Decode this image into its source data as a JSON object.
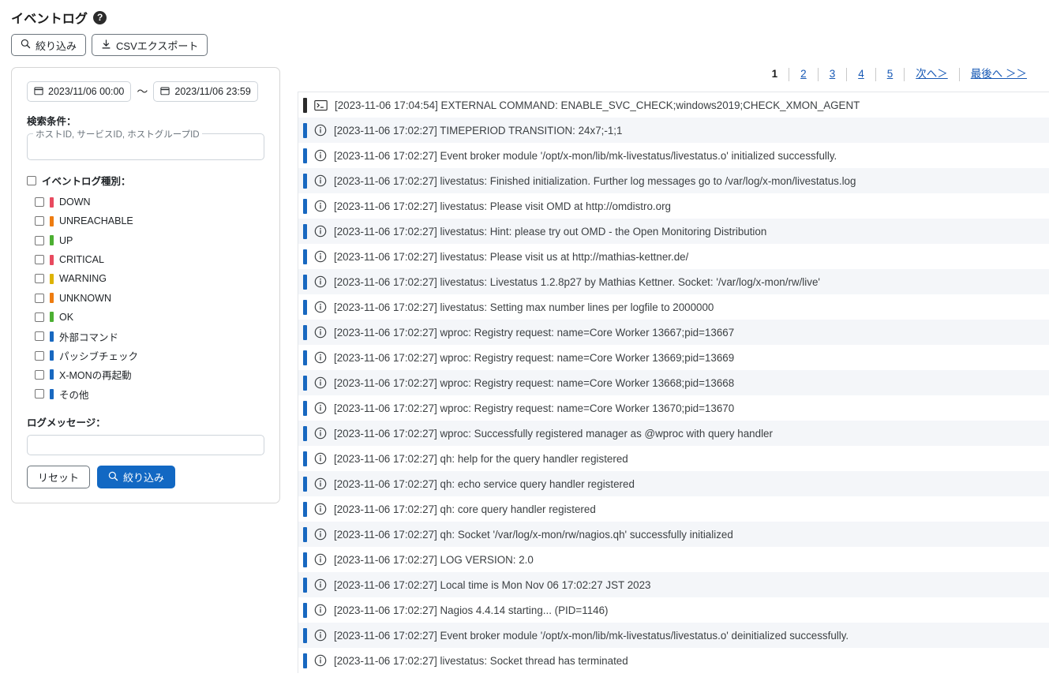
{
  "header": {
    "title": "イベントログ",
    "help_icon": "help-circle-icon",
    "help_label": "?",
    "toolbar": [
      {
        "label": "絞り込み",
        "icon": "search-icon"
      },
      {
        "label": "CSVエクスポート",
        "icon": "download-icon"
      }
    ]
  },
  "filter": {
    "date_from": "2023/11/06 00:00",
    "date_to": "2023/11/06 23:59",
    "date_separator": "～",
    "calendar_icon": "calendar-icon",
    "search_condition_label": "検索条件：",
    "id_field_legend": "ホストID, サービスID, ホストグループID",
    "id_field_value": "",
    "category_label": "イベントログ種別：",
    "categories": [
      {
        "label": "DOWN",
        "color": "#e84a5f",
        "checked": false
      },
      {
        "label": "UNREACHABLE",
        "color": "#ee7c10",
        "checked": false
      },
      {
        "label": "UP",
        "color": "#4caf32",
        "checked": false
      },
      {
        "label": "CRITICAL",
        "color": "#e84a5f",
        "checked": false
      },
      {
        "label": "WARNING",
        "color": "#ddb302",
        "checked": false
      },
      {
        "label": "UNKNOWN",
        "color": "#ee7c10",
        "checked": false
      },
      {
        "label": "OK",
        "color": "#4caf32",
        "checked": false
      },
      {
        "label": "外部コマンド",
        "color": "#1868c0",
        "checked": false
      },
      {
        "label": "パッシブチェック",
        "color": "#1868c0",
        "checked": false
      },
      {
        "label": "X-MONの再起動",
        "color": "#1868c0",
        "checked": false
      },
      {
        "label": "その他",
        "color": "#1868c0",
        "checked": false
      }
    ],
    "log_message_label": "ログメッセージ：",
    "log_message_value": "",
    "log_message_placeholder": "",
    "reset_label": "リセット",
    "apply_label": "絞り込み",
    "apply_icon": "search-icon"
  },
  "pagination": {
    "pages": [
      {
        "label": "1",
        "current": true
      },
      {
        "label": "2",
        "current": false
      },
      {
        "label": "3",
        "current": false
      },
      {
        "label": "4",
        "current": false
      },
      {
        "label": "5",
        "current": false
      },
      {
        "label": "次へ＞",
        "current": false
      },
      {
        "label": "最後へ ＞＞",
        "current": false
      }
    ]
  },
  "log_rows": [
    {
      "bar_color": "#2b2b2b",
      "icon": "terminal-icon",
      "text": "[2023-11-06 17:04:54] EXTERNAL COMMAND: ENABLE_SVC_CHECK;windows2019;CHECK_XMON_AGENT"
    },
    {
      "bar_color": "#1868c0",
      "icon": "info-circle-icon",
      "text": "[2023-11-06 17:02:27] TIMEPERIOD TRANSITION: 24x7;-1;1"
    },
    {
      "bar_color": "#1868c0",
      "icon": "info-circle-icon",
      "text": "[2023-11-06 17:02:27] Event broker module '/opt/x-mon/lib/mk-livestatus/livestatus.o' initialized successfully."
    },
    {
      "bar_color": "#1868c0",
      "icon": "info-circle-icon",
      "text": "[2023-11-06 17:02:27] livestatus: Finished initialization. Further log messages go to /var/log/x-mon/livestatus.log"
    },
    {
      "bar_color": "#1868c0",
      "icon": "info-circle-icon",
      "text": "[2023-11-06 17:02:27] livestatus: Please visit OMD at http://omdistro.org"
    },
    {
      "bar_color": "#1868c0",
      "icon": "info-circle-icon",
      "text": "[2023-11-06 17:02:27] livestatus: Hint: please try out OMD - the Open Monitoring Distribution"
    },
    {
      "bar_color": "#1868c0",
      "icon": "info-circle-icon",
      "text": "[2023-11-06 17:02:27] livestatus: Please visit us at http://mathias-kettner.de/"
    },
    {
      "bar_color": "#1868c0",
      "icon": "info-circle-icon",
      "text": "[2023-11-06 17:02:27] livestatus: Livestatus 1.2.8p27 by Mathias Kettner. Socket: '/var/log/x-mon/rw/live'"
    },
    {
      "bar_color": "#1868c0",
      "icon": "info-circle-icon",
      "text": "[2023-11-06 17:02:27] livestatus: Setting max number lines per logfile to 2000000"
    },
    {
      "bar_color": "#1868c0",
      "icon": "info-circle-icon",
      "text": "[2023-11-06 17:02:27] wproc: Registry request: name=Core Worker 13667;pid=13667"
    },
    {
      "bar_color": "#1868c0",
      "icon": "info-circle-icon",
      "text": "[2023-11-06 17:02:27] wproc: Registry request: name=Core Worker 13669;pid=13669"
    },
    {
      "bar_color": "#1868c0",
      "icon": "info-circle-icon",
      "text": "[2023-11-06 17:02:27] wproc: Registry request: name=Core Worker 13668;pid=13668"
    },
    {
      "bar_color": "#1868c0",
      "icon": "info-circle-icon",
      "text": "[2023-11-06 17:02:27] wproc: Registry request: name=Core Worker 13670;pid=13670"
    },
    {
      "bar_color": "#1868c0",
      "icon": "info-circle-icon",
      "text": "[2023-11-06 17:02:27] wproc: Successfully registered manager as @wproc with query handler"
    },
    {
      "bar_color": "#1868c0",
      "icon": "info-circle-icon",
      "text": "[2023-11-06 17:02:27] qh: help for the query handler registered"
    },
    {
      "bar_color": "#1868c0",
      "icon": "info-circle-icon",
      "text": "[2023-11-06 17:02:27] qh: echo service query handler registered"
    },
    {
      "bar_color": "#1868c0",
      "icon": "info-circle-icon",
      "text": "[2023-11-06 17:02:27] qh: core query handler registered"
    },
    {
      "bar_color": "#1868c0",
      "icon": "info-circle-icon",
      "text": "[2023-11-06 17:02:27] qh: Socket '/var/log/x-mon/rw/nagios.qh' successfully initialized"
    },
    {
      "bar_color": "#1868c0",
      "icon": "info-circle-icon",
      "text": "[2023-11-06 17:02:27] LOG VERSION: 2.0"
    },
    {
      "bar_color": "#1868c0",
      "icon": "info-circle-icon",
      "text": "[2023-11-06 17:02:27] Local time is Mon Nov 06 17:02:27 JST 2023"
    },
    {
      "bar_color": "#1868c0",
      "icon": "info-circle-icon",
      "text": "[2023-11-06 17:02:27] Nagios 4.4.14 starting... (PID=1146)"
    },
    {
      "bar_color": "#1868c0",
      "icon": "info-circle-icon",
      "text": "[2023-11-06 17:02:27] Event broker module '/opt/x-mon/lib/mk-livestatus/livestatus.o' deinitialized successfully."
    },
    {
      "bar_color": "#1868c0",
      "icon": "info-circle-icon",
      "text": "[2023-11-06 17:02:27] livestatus: Socket thread has terminated"
    }
  ]
}
